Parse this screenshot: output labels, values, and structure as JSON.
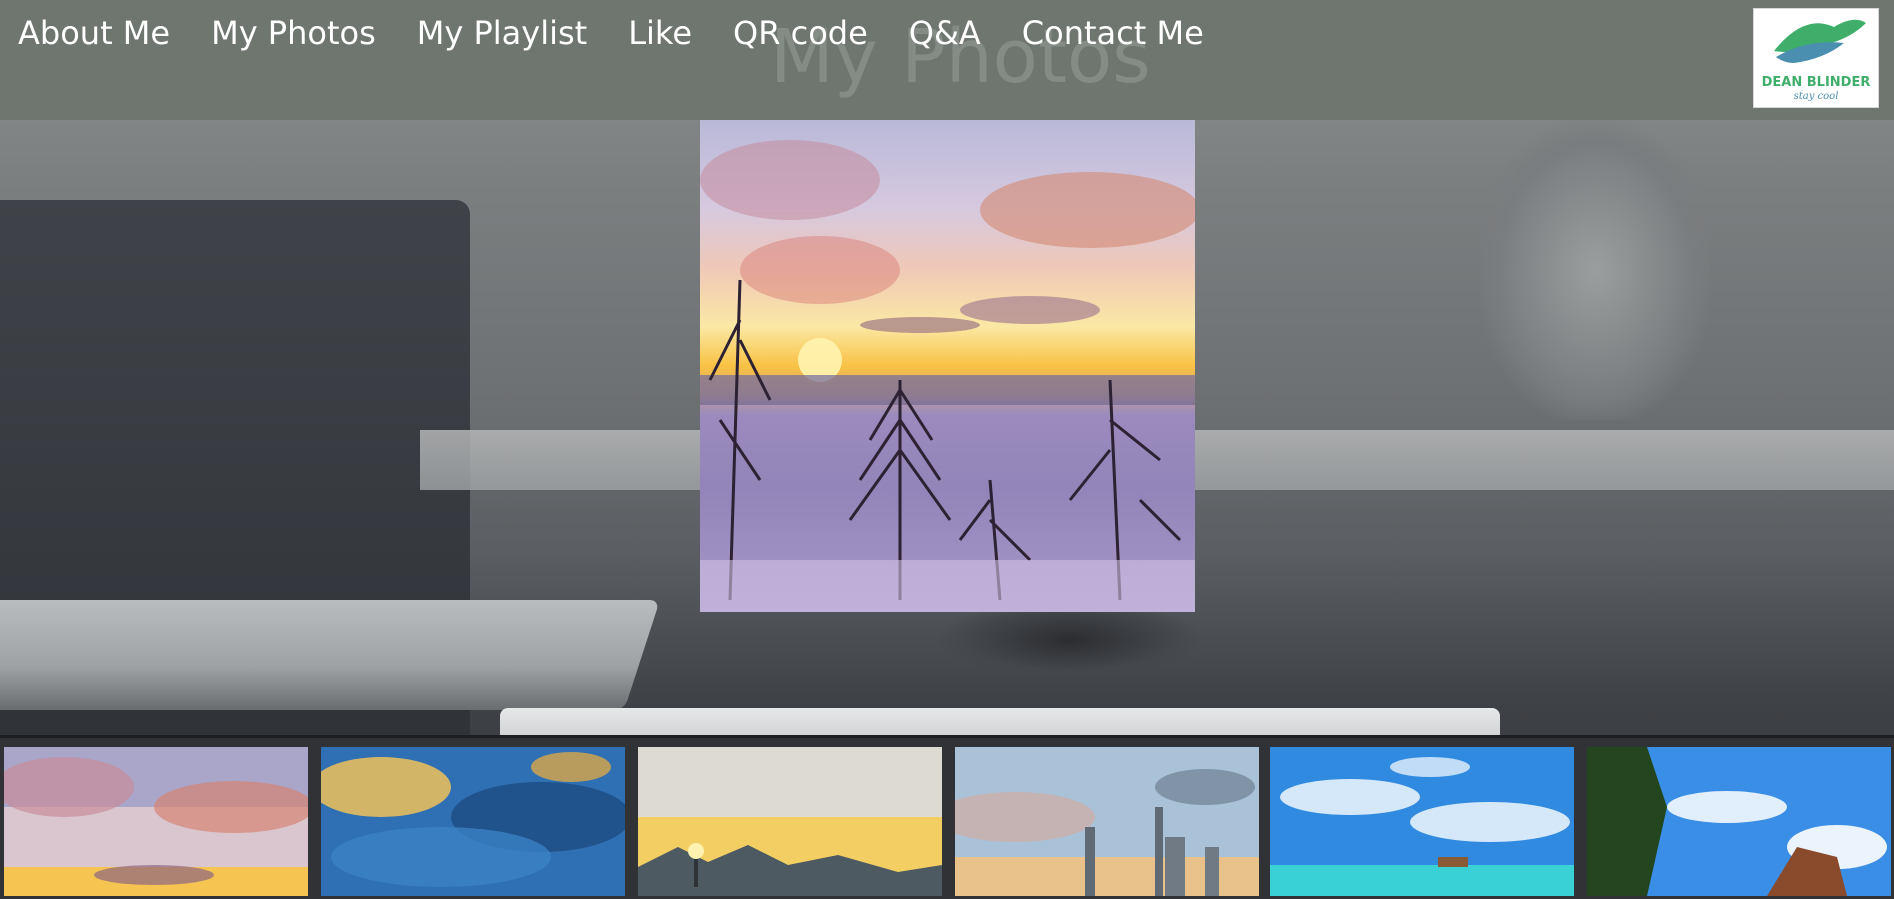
{
  "nav": {
    "items": [
      {
        "label": "About Me"
      },
      {
        "label": "My Photos"
      },
      {
        "label": "My Playlist"
      },
      {
        "label": "Like"
      },
      {
        "label": "QR code"
      },
      {
        "label": "Q&A"
      },
      {
        "label": "Contact Me"
      }
    ]
  },
  "page_title": "My Photos",
  "logo": {
    "name": "DEAN BLINDER",
    "tagline": "stay cool"
  },
  "main_photo": {
    "subject": "sunset-snow-trees-photo"
  },
  "thumbnails": [
    {
      "subject": "sunset-clouds-thumbnail"
    },
    {
      "subject": "sun-rays-clouds-thumbnail"
    },
    {
      "subject": "mountain-sunset-thumbnail"
    },
    {
      "subject": "city-skyline-thumbnail"
    },
    {
      "subject": "ocean-hut-thumbnail"
    },
    {
      "subject": "beach-palm-thumbnail"
    }
  ],
  "colors": {
    "navbar": "#6f756f",
    "nav_text": "#ffffff",
    "title_text": "#8a918b"
  }
}
